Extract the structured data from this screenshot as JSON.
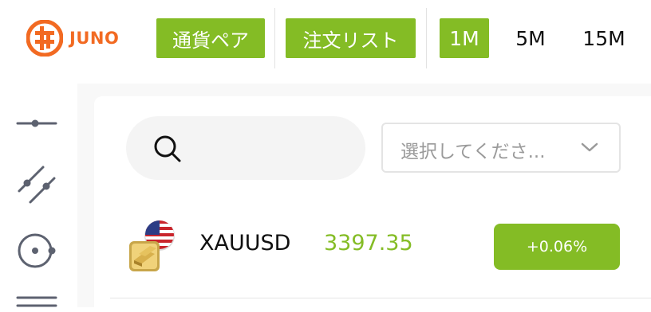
{
  "header": {
    "brand": "JUNO",
    "brand_color": "#f26a22",
    "accent_color": "#84bc25",
    "buttons": {
      "currency_pairs": "通貨ペア",
      "order_list": "注文リスト"
    },
    "timeframes": [
      {
        "label": "1M",
        "active": true
      },
      {
        "label": "5M",
        "active": false
      },
      {
        "label": "15M",
        "active": false
      }
    ]
  },
  "sidebar": {
    "tools": [
      "horizontal-line-icon",
      "parallel-channel-icon",
      "circle-tool-icon",
      "fib-lines-icon"
    ]
  },
  "filter": {
    "search_icon": "search-icon",
    "select_placeholder": "選択してくださ...",
    "select_icon": "chevron-down-icon"
  },
  "instruments": [
    {
      "symbol": "XAUUSD",
      "price": "3397.35",
      "change": "+0.06%",
      "icon": "gold-usd-flag-icon"
    }
  ]
}
